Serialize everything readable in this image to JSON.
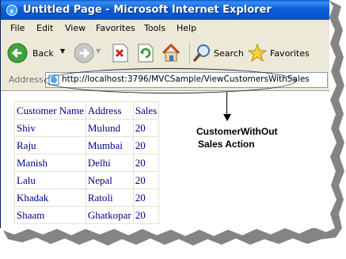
{
  "window": {
    "title": "Untitled Page - Microsoft Internet Explorer"
  },
  "menu": {
    "items": [
      "File",
      "Edit",
      "View",
      "Favorites",
      "Tools",
      "Help"
    ]
  },
  "toolbar": {
    "back_label": "Back",
    "search_label": "Search",
    "favorites_label": "Favorites"
  },
  "address": {
    "label": "Address",
    "url": "http://localhost:3796/MVCSample/ViewCustomersWithSales"
  },
  "table": {
    "headers": [
      "Customer Name",
      "Address",
      "Sales"
    ],
    "rows": [
      [
        "Shiv",
        "Mulund",
        "20"
      ],
      [
        "Raju",
        "Mumbai",
        "20"
      ],
      [
        "Manish",
        "Delhi",
        "20"
      ],
      [
        "Lalu",
        "Nepal",
        "20"
      ],
      [
        "Khadak",
        "Ratoli",
        "20"
      ],
      [
        "Shaam",
        "Ghatkopar",
        "20"
      ]
    ]
  },
  "annotation": {
    "line1": "CustomerWithOut",
    "line2": "Sales Action"
  },
  "colors": {
    "titlebar": "#0a5fd8",
    "chrome": "#ece9d8",
    "table_text": "#00008b"
  },
  "icons": [
    "ie-logo-icon",
    "back-arrow-icon",
    "forward-arrow-icon",
    "stop-icon",
    "refresh-icon",
    "home-icon",
    "search-magnifier-icon",
    "favorites-star-icon",
    "page-icon"
  ]
}
